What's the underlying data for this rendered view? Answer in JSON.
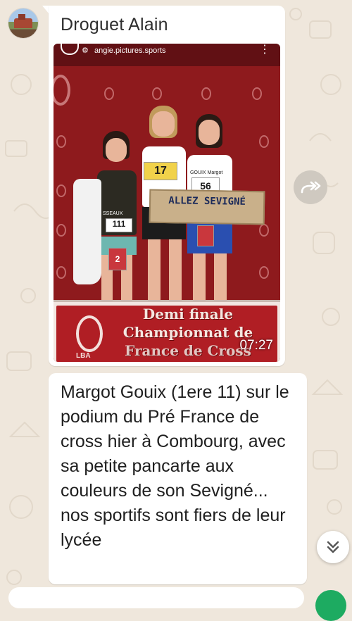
{
  "chat": {
    "sender_name": "Droguet Alain",
    "sender_avatar": "avatar-photo",
    "message_image": {
      "instagram_account": "angie.pictures.sports",
      "video_duration": "07:27",
      "sign_line1": "ALLEZ",
      "sign_line2": "SEVIGNÉ",
      "bib_left": "111",
      "bib_center": "17",
      "bib_right": "56",
      "bib_left_name": "SSEAUX",
      "bib_right_name": "GOUIX Margot",
      "podium_place_left": "2",
      "banner_line1": "Demi finale",
      "banner_line2": "Championnat de",
      "banner_line3": "France de Cross",
      "banner_logo_text": "LBA"
    },
    "message_text": "Margot Gouix (1ere 11) sur le podium du Pré France de cross hier à Combourg, avec sa petite pancarte aux couleurs de son Sevigné... nos sportifs sont fiers de leur lycée"
  },
  "icons": {
    "share": "forward-arrows-icon",
    "scroll_down": "double-chevron-down-icon",
    "instagram_more": "more-vertical-icon"
  },
  "colors": {
    "chat_background": "#efe7dc",
    "bubble": "#ffffff",
    "photo_backdrop": "#8e1a1d",
    "banner": "#b01e24",
    "mic_button": "#1dab61"
  }
}
